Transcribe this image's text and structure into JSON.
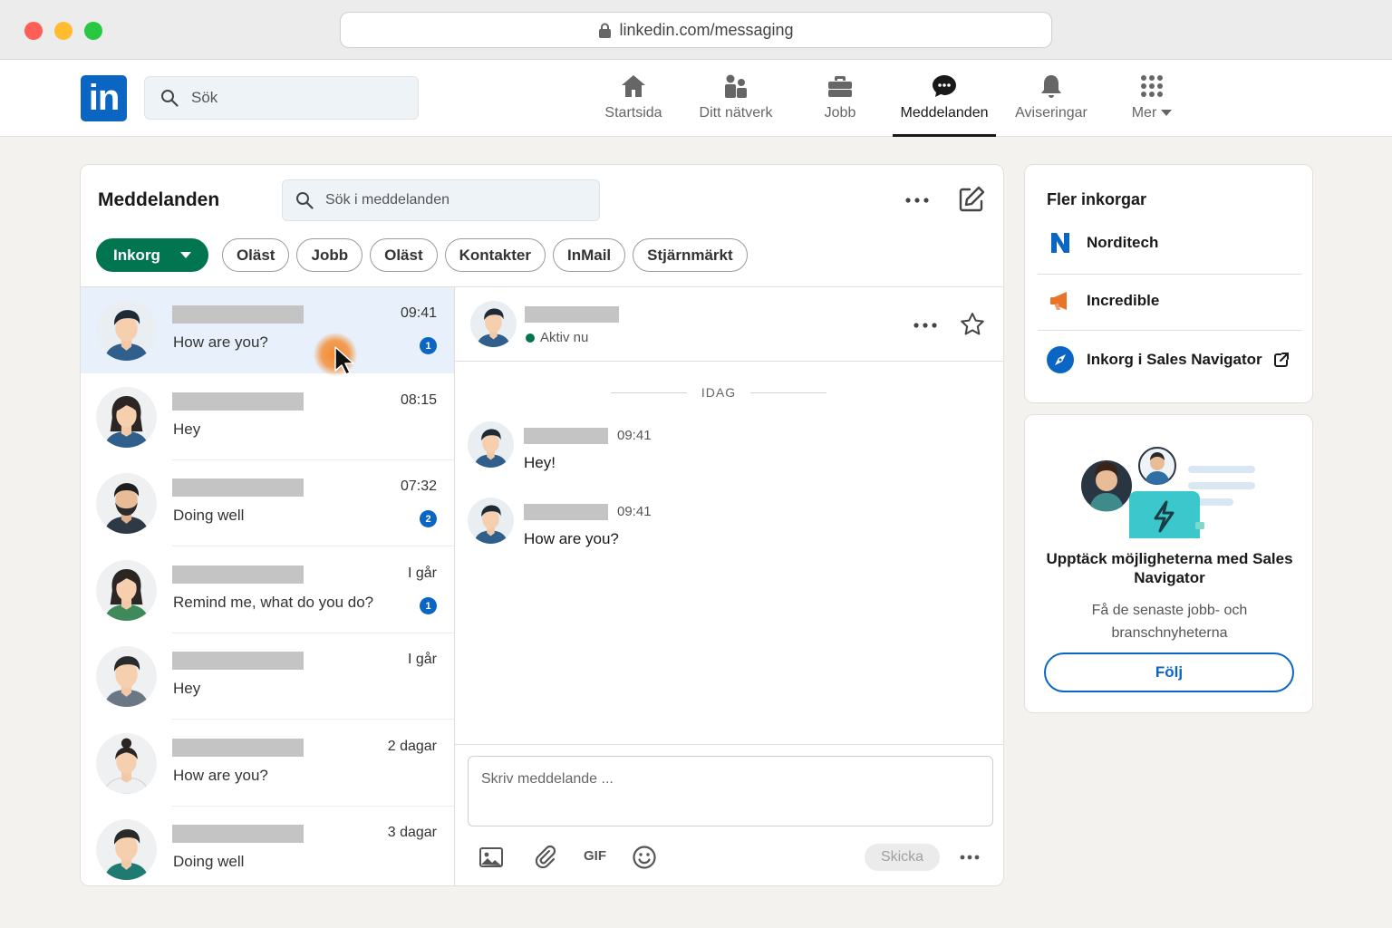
{
  "browser": {
    "url": "linkedin.com/messaging"
  },
  "nav": {
    "logo": "in",
    "search_placeholder": "Sök",
    "items": [
      {
        "label": "Startsida",
        "icon": "home-icon"
      },
      {
        "label": "Ditt nätverk",
        "icon": "network-icon"
      },
      {
        "label": "Jobb",
        "icon": "briefcase-icon"
      },
      {
        "label": "Meddelanden",
        "icon": "messaging-icon",
        "active": true
      },
      {
        "label": "Aviseringar",
        "icon": "bell-icon"
      },
      {
        "label": "Mer",
        "icon": "grid-icon"
      }
    ]
  },
  "messaging": {
    "title": "Meddelanden",
    "search_placeholder": "Sök i meddelanden",
    "filters": {
      "primary": "Inkorg",
      "pills": [
        "Oläst",
        "Jobb",
        "Oläst",
        "Kontakter",
        "InMail",
        "Stjärnmärkt"
      ]
    },
    "conversations": [
      {
        "time": "09:41",
        "snippet": "How are you?",
        "badge": "1",
        "selected": true
      },
      {
        "time": "08:15",
        "snippet": "Hey",
        "badge": ""
      },
      {
        "time": "07:32",
        "snippet": "Doing well",
        "badge": "2"
      },
      {
        "time": "I går",
        "snippet": "Remind me, what do you do?",
        "badge": "1"
      },
      {
        "time": "I går",
        "snippet": "Hey",
        "badge": ""
      },
      {
        "time": "2 dagar",
        "snippet": "How are you?",
        "badge": ""
      },
      {
        "time": "3 dagar",
        "snippet": "Doing well",
        "badge": ""
      }
    ],
    "thread": {
      "status": "Aktiv nu",
      "day_divider": "IDAG",
      "messages": [
        {
          "time": "09:41",
          "text": "Hey!"
        },
        {
          "time": "09:41",
          "text": "How are you?"
        }
      ],
      "composer_placeholder": "Skriv meddelande ...",
      "gif_label": "GIF",
      "send_label": "Skicka"
    }
  },
  "right": {
    "inboxes_title": "Fler inkorgar",
    "inboxes": [
      {
        "label": "Norditech",
        "icon": "norditech-logo-icon",
        "color": "#0a66c2"
      },
      {
        "label": "Incredible",
        "icon": "incredible-logo-icon",
        "color": "#e8742a"
      },
      {
        "label": "Inkorg i Sales Navigator",
        "icon": "compass-icon",
        "color": "#0a66c2"
      }
    ],
    "promo": {
      "title": "Upptäck möjligheterna med Sales Navigator",
      "subtitle": "Få de senaste jobb- och branschnyheterna",
      "button": "Följ"
    }
  },
  "colors": {
    "brand": "#0a66c2",
    "green": "#01754f",
    "selected_row": "#e8f1fb",
    "cursor_highlight": "#f58220"
  }
}
